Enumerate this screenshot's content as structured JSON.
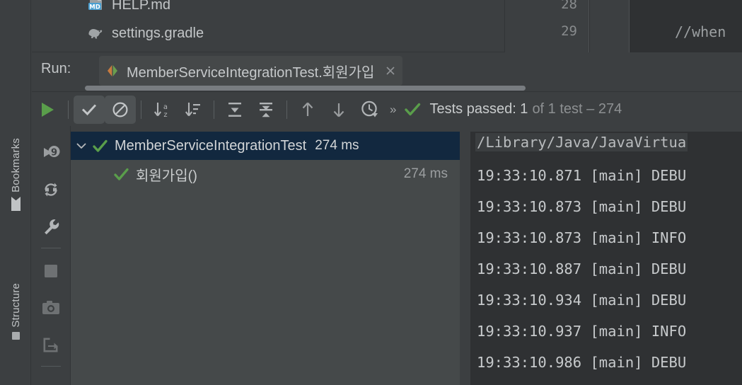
{
  "window": {
    "theme_bg": "#3c3f41",
    "console_bg": "#2f3133",
    "selection_bg": "#12283f",
    "accent_green": "#5a9e4b"
  },
  "left_strip": {
    "bookmarks_label": "Bookmarks",
    "structure_label": "Structure"
  },
  "project_files": [
    {
      "name": "HELP.md",
      "icon": "markdown-file-icon",
      "badge": "MD"
    },
    {
      "name": "settings.gradle",
      "icon": "gradle-elephant-icon"
    }
  ],
  "editor": {
    "line_numbers": [
      "28",
      "29"
    ],
    "code_lines": [
      "",
      "//when"
    ]
  },
  "run_panel": {
    "label": "Run:",
    "tab": {
      "title": "MemberServiceIntegrationTest.회원가입",
      "config_icon": "run-configuration-icon",
      "close_icon": "close-icon"
    },
    "toolbar": {
      "rerun_label": "Rerun",
      "show_passed_label": "Show Passed",
      "show_ignored_label": "Show Ignored",
      "sort_alphabetically_label": "Sort Alphabetically",
      "sort_by_duration_label": "Sort by Duration",
      "expand_all_label": "Expand All",
      "collapse_all_label": "Collapse All",
      "prev_label": "Previous Failed Test",
      "next_label": "Next Failed Test",
      "history_label": "Test History",
      "overflow_label": "»"
    },
    "status": {
      "check_icon": "check-icon",
      "main": "Tests passed: 1",
      "dim": "of 1 test – 274"
    }
  },
  "test_tree": {
    "rows": [
      {
        "name": "MemberServiceIntegrationTest",
        "time": "274 ms",
        "state": "passed",
        "selected": true,
        "expanded": true,
        "indent": 0
      },
      {
        "name": "회원가입()",
        "time": "274 ms",
        "state": "passed",
        "selected": false,
        "indent": 1
      }
    ]
  },
  "console": {
    "lines": [
      {
        "text": "/Library/Java/JavaVirtua",
        "highlight": true
      },
      {
        "text": "19:33:10.871 [main] DEBU",
        "highlight": false
      },
      {
        "text": "19:33:10.873 [main] DEBU",
        "highlight": false
      },
      {
        "text": "19:33:10.873 [main] INFO",
        "highlight": false
      },
      {
        "text": "19:33:10.887 [main] DEBU",
        "highlight": false
      },
      {
        "text": "19:33:10.934 [main] DEBU",
        "highlight": false
      },
      {
        "text": "19:33:10.937 [main] INFO",
        "highlight": false
      },
      {
        "text": "19:33:10.986 [main] DEBU",
        "highlight": false
      }
    ]
  }
}
